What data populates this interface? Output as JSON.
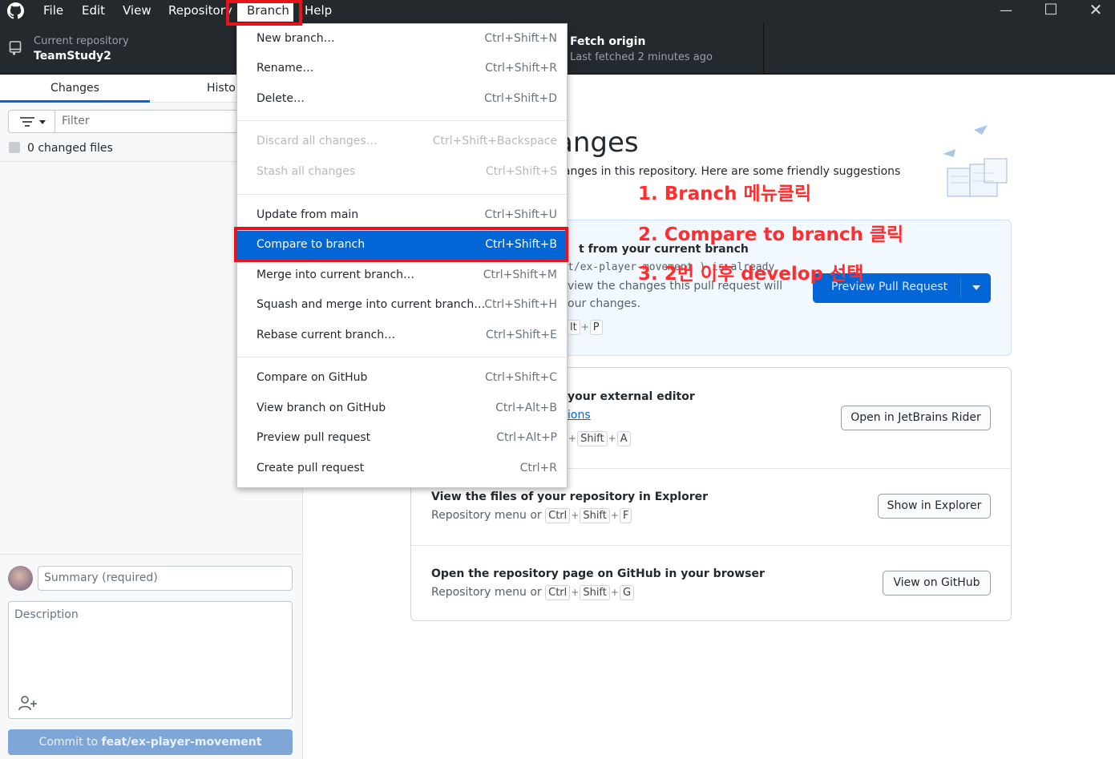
{
  "menubar": {
    "items": [
      "File",
      "Edit",
      "View",
      "Repository",
      "Branch",
      "Help"
    ],
    "window_controls": [
      "minimize-icon",
      "maximize-icon",
      "close-icon"
    ]
  },
  "toolbar": {
    "repo_caption": "Current repository",
    "repo_name": "TeamStudy2",
    "fetch_title": "Fetch origin",
    "fetch_sub": "Last fetched 2 minutes ago"
  },
  "sidebar": {
    "tabs": [
      "Changes",
      "Histo"
    ],
    "filter_placeholder": "Filter",
    "changed_files": "0 changed files",
    "summary_placeholder": "Summary (required)",
    "description_placeholder": "Description",
    "commit_prefix": "Commit to ",
    "commit_branch": "feat/ex-player-movement"
  },
  "branch_menu": {
    "items": [
      {
        "label": "New branch…",
        "accel": "Ctrl+Shift+N"
      },
      {
        "label": "Rename…",
        "accel": "Ctrl+Shift+R"
      },
      {
        "label": "Delete…",
        "accel": "Ctrl+Shift+D"
      },
      {
        "label": "Discard all changes…",
        "accel": "Ctrl+Shift+Backspace"
      },
      {
        "label": "Stash all changes",
        "accel": "Ctrl+Shift+S"
      },
      {
        "label": "Update from main",
        "accel": "Ctrl+Shift+U"
      },
      {
        "label": "Compare to branch",
        "accel": "Ctrl+Shift+B"
      },
      {
        "label": "Merge into current branch…",
        "accel": "Ctrl+Shift+M"
      },
      {
        "label": "Squash and merge into current branch…",
        "accel": "Ctrl+Shift+H"
      },
      {
        "label": "Rebase current branch…",
        "accel": "Ctrl+Shift+E"
      },
      {
        "label": "Compare on GitHub",
        "accel": "Ctrl+Shift+C"
      },
      {
        "label": "View branch on GitHub",
        "accel": "Ctrl+Alt+B"
      },
      {
        "label": "Preview pull request",
        "accel": "Ctrl+Alt+P"
      },
      {
        "label": "Create pull request",
        "accel": "Ctrl+R"
      }
    ]
  },
  "main": {
    "title": "anges",
    "subtitle": "hanges in this repository. Here are some friendly suggestions",
    "pr_card": {
      "title": "t from your current branch",
      "line1": "t/ex-player-movement ) is already",
      "line2": "view the changes this pull request will",
      "line3": "our changes.",
      "kbd_alt": "lt",
      "kbd_p": "P",
      "button": "Preview Pull Request"
    },
    "editor_row": {
      "title": "your external editor",
      "link": "ions",
      "kbd_shift": "Shift",
      "kbd_a": "A",
      "button": "Open in JetBrains Rider"
    },
    "explorer_row": {
      "title": "View the files of your repository in Explorer",
      "sub": "Repository menu or",
      "kbd_ctrl": "Ctrl",
      "kbd_shift": "Shift",
      "kbd_f": "F",
      "button": "Show in Explorer"
    },
    "github_row": {
      "title": "Open the repository page on GitHub in your browser",
      "sub": "Repository menu or",
      "kbd_ctrl": "Ctrl",
      "kbd_shift": "Shift",
      "kbd_g": "G",
      "button": "View on GitHub"
    }
  },
  "annotations": {
    "step1": "1. Branch 메뉴클릭",
    "step2": "2. Compare to branch 클릭",
    "step3": "3. 2번 이후 develop 선택",
    "color": "#ff2d2d"
  },
  "colors": {
    "accent": "#0366d6",
    "dark": "#24292e",
    "annotation_box": "#e8141c"
  }
}
